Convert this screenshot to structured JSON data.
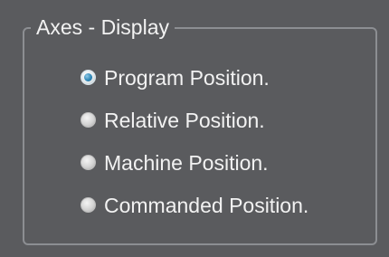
{
  "group": {
    "title": "Axes - Display"
  },
  "options": [
    {
      "label": "Program Position.",
      "checked": true
    },
    {
      "label": "Relative Position.",
      "checked": false
    },
    {
      "label": "Machine Position.",
      "checked": false
    },
    {
      "label": "Commanded Position.",
      "checked": false
    }
  ],
  "colors": {
    "background": "#5a5b5e",
    "frame": "#8c8e92",
    "text": "#f2f2f2",
    "selected_dot": "#2f87b7"
  },
  "icons": {
    "selected": "radio-selected-icon",
    "unselected": "radio-unselected-icon"
  }
}
